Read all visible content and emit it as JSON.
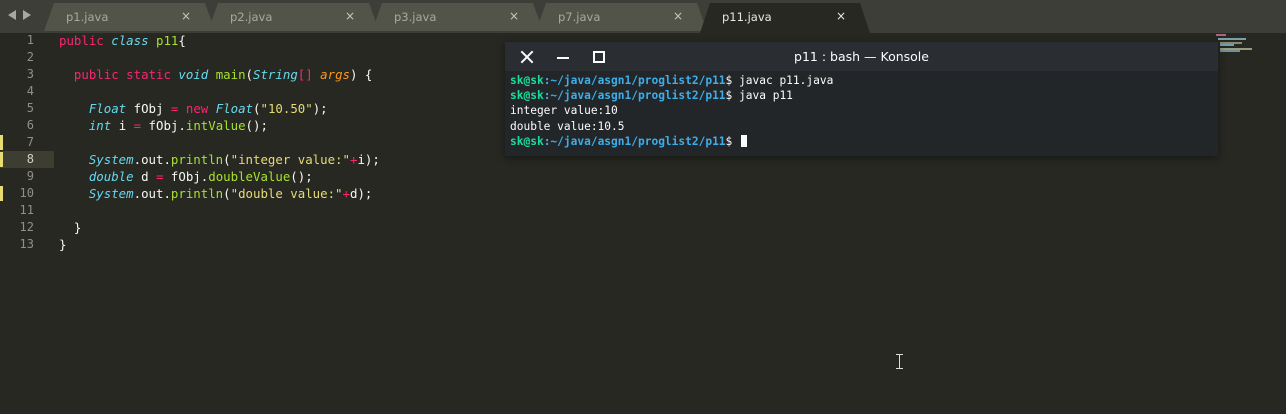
{
  "tabs": [
    {
      "label": "p1.java",
      "active": false
    },
    {
      "label": "p2.java",
      "active": false
    },
    {
      "label": "p3.java",
      "active": false
    },
    {
      "label": "p7.java",
      "active": false
    },
    {
      "label": "p11.java",
      "active": true
    }
  ],
  "tab_close_glyph": "×",
  "editor": {
    "line_numbers": [
      "1",
      "2",
      "3",
      "4",
      "5",
      "6",
      "7",
      "8",
      "9",
      "10",
      "11",
      "12",
      "13"
    ],
    "current_line": 8,
    "modified_lines": [
      7,
      8,
      10
    ],
    "lines": [
      [
        {
          "t": "public",
          "c": "kw"
        },
        {
          "t": " "
        },
        {
          "t": "class",
          "c": "type"
        },
        {
          "t": " "
        },
        {
          "t": "p11",
          "c": "fn"
        },
        {
          "t": "{"
        }
      ],
      [],
      [
        {
          "t": "  "
        },
        {
          "t": "public",
          "c": "kw"
        },
        {
          "t": " "
        },
        {
          "t": "static",
          "c": "kw"
        },
        {
          "t": " "
        },
        {
          "t": "void",
          "c": "type"
        },
        {
          "t": " "
        },
        {
          "t": "main",
          "c": "fn"
        },
        {
          "t": "("
        },
        {
          "t": "String",
          "c": "type"
        },
        {
          "t": "[]",
          "c": "kw"
        },
        {
          "t": " "
        },
        {
          "t": "args",
          "c": "param"
        },
        {
          "t": ") {"
        }
      ],
      [],
      [
        {
          "t": "    "
        },
        {
          "t": "Float",
          "c": "type"
        },
        {
          "t": " fObj "
        },
        {
          "t": "=",
          "c": "kw"
        },
        {
          "t": " "
        },
        {
          "t": "new",
          "c": "kw"
        },
        {
          "t": " "
        },
        {
          "t": "Float",
          "c": "type"
        },
        {
          "t": "("
        },
        {
          "t": "\"10.50\"",
          "c": "str"
        },
        {
          "t": ");"
        }
      ],
      [
        {
          "t": "    "
        },
        {
          "t": "int",
          "c": "type"
        },
        {
          "t": " i "
        },
        {
          "t": "=",
          "c": "kw"
        },
        {
          "t": " fObj."
        },
        {
          "t": "intValue",
          "c": "fn"
        },
        {
          "t": "();"
        }
      ],
      [],
      [
        {
          "t": "    "
        },
        {
          "t": "System",
          "c": "type"
        },
        {
          "t": ".out."
        },
        {
          "t": "println",
          "c": "fn"
        },
        {
          "t": "("
        },
        {
          "t": "\"integer value:\"",
          "c": "str"
        },
        {
          "t": "+",
          "c": "kw"
        },
        {
          "t": "i);"
        }
      ],
      [
        {
          "t": "    "
        },
        {
          "t": "double",
          "c": "type"
        },
        {
          "t": " d "
        },
        {
          "t": "=",
          "c": "kw"
        },
        {
          "t": " fObj."
        },
        {
          "t": "doubleValue",
          "c": "fn"
        },
        {
          "t": "();"
        }
      ],
      [
        {
          "t": "    "
        },
        {
          "t": "System",
          "c": "type"
        },
        {
          "t": ".out."
        },
        {
          "t": "println",
          "c": "fn"
        },
        {
          "t": "("
        },
        {
          "t": "\"double value:\"",
          "c": "str"
        },
        {
          "t": "+",
          "c": "kw"
        },
        {
          "t": "d);"
        }
      ],
      [],
      [
        {
          "t": "  }"
        }
      ],
      [
        {
          "t": "}"
        }
      ]
    ]
  },
  "konsole": {
    "title": "p11 : bash — Konsole",
    "user_host": "sk@sk",
    "path": ":~/java/asgn1/proglist2/p11",
    "prompt_symbol": "$",
    "lines": [
      {
        "type": "prompt",
        "command": " javac p11.java"
      },
      {
        "type": "prompt",
        "command": " java p11"
      },
      {
        "type": "output",
        "text": "integer value:10"
      },
      {
        "type": "output",
        "text": "double value:10.5"
      },
      {
        "type": "prompt",
        "command": " ",
        "cursor": true
      }
    ]
  },
  "colors": {
    "editor_bg": "#272822",
    "keyword": "#f92672",
    "type": "#66d9ef",
    "function": "#a6e22e",
    "string": "#e6db74",
    "terminal_user": "#1cdc9a",
    "terminal_path": "#3daee9"
  }
}
